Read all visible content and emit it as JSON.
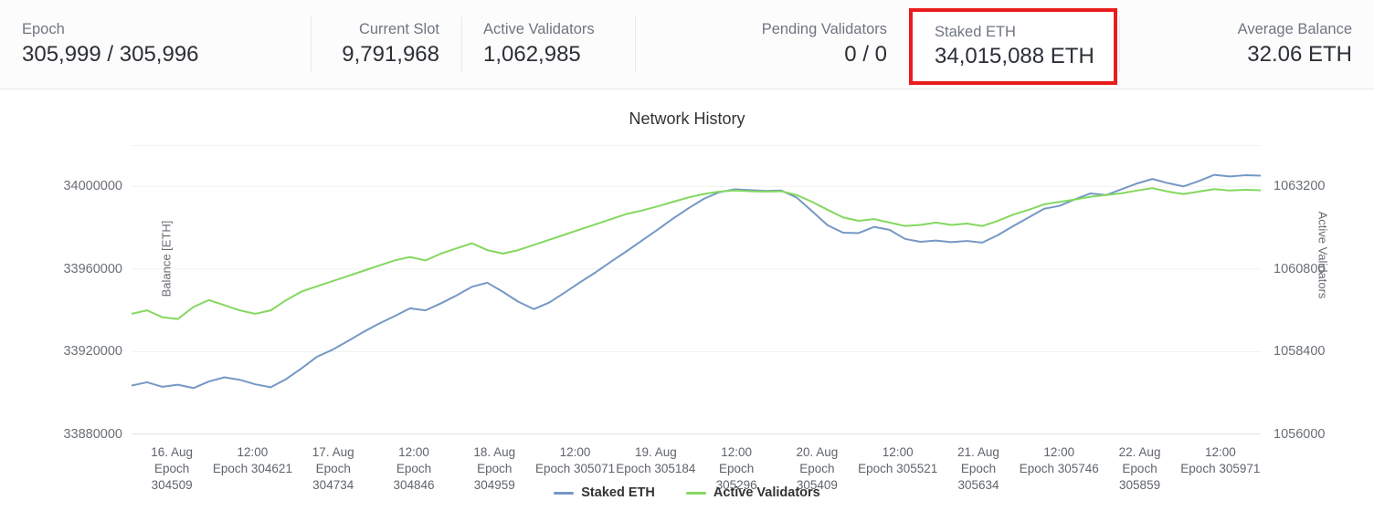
{
  "stats": [
    {
      "id": "epoch",
      "label": "Epoch",
      "value": "305,999 / 305,996",
      "align": "left"
    },
    {
      "id": "current-slot",
      "label": "Current Slot",
      "value": "9,791,968",
      "align": "right"
    },
    {
      "id": "active-validators",
      "label": "Active Validators",
      "value": "1,062,985",
      "align": "left"
    },
    {
      "id": "pending-validators",
      "label": "Pending Validators",
      "value": "0 / 0",
      "align": "right"
    },
    {
      "id": "staked-eth",
      "label": "Staked ETH",
      "value": "34,015,088 ETH",
      "align": "left"
    },
    {
      "id": "average-balance",
      "label": "Average Balance",
      "value": "32.06 ETH",
      "align": "right"
    }
  ],
  "highlight": {
    "target": "staked-eth",
    "color": "#e81c1c",
    "label": "Staked ETH",
    "value": "34,015,088 ETH"
  },
  "chart_data": {
    "type": "line",
    "title": "Network History",
    "xlabel": "",
    "ylabel": "Balance [ETH]",
    "y2label": "Active Validators",
    "grid": true,
    "legend_position": "bottom",
    "ylim": [
      33880000,
      34020000
    ],
    "yticks": [
      33880000,
      33920000,
      33960000,
      34000000
    ],
    "ytick_labels": [
      "33880000",
      "33920000",
      "33960000",
      "34000000"
    ],
    "y2lim": [
      1056000,
      1064400
    ],
    "y2ticks": [
      1056000,
      1058400,
      1060800,
      1063200
    ],
    "y2tick_labels": [
      "1056000",
      "1058400",
      "1060800",
      "1063200"
    ],
    "xtick_labels": [
      "16. Aug\nEpoch\n304509",
      "12:00\nEpoch 304621",
      "17. Aug\nEpoch\n304734",
      "12:00\nEpoch\n304846",
      "18. Aug\nEpoch\n304959",
      "12:00\nEpoch 305071",
      "19. Aug\nEpoch 305184",
      "12:00\nEpoch\n305296",
      "20. Aug\nEpoch\n305409",
      "12:00\nEpoch 305521",
      "21. Aug\nEpoch\n305634",
      "12:00\nEpoch 305746",
      "22. Aug\nEpoch\n305859",
      "12:00\nEpoch 305971"
    ],
    "xtick_widths": [
      "narrow",
      "wide",
      "narrow",
      "narrow",
      "narrow",
      "wide",
      "wide",
      "narrow",
      "narrow",
      "wide",
      "narrow",
      "wide",
      "narrow",
      "wide"
    ],
    "series": [
      {
        "name": "Staked ETH",
        "color": "#7598c4",
        "axis": "left",
        "values": [
          33903600,
          33905200,
          33903000,
          33904000,
          33902400,
          33905600,
          33907600,
          33906400,
          33904200,
          33902800,
          33906800,
          33912000,
          33917600,
          33921000,
          33925200,
          33929600,
          33933600,
          33937200,
          33941000,
          33940000,
          33943400,
          33947200,
          33951400,
          33953400,
          33949000,
          33944200,
          33940600,
          33943800,
          33948600,
          33953600,
          33958400,
          33963600,
          33968600,
          33973800,
          33979000,
          33984400,
          33989400,
          33994000,
          33997200,
          33998600,
          33998200,
          33997800,
          33998000,
          33994600,
          33988000,
          33981200,
          33977600,
          33977400,
          33980400,
          33979000,
          33974600,
          33973200,
          33973800,
          33973000,
          33973600,
          33972800,
          33976400,
          33980800,
          33985000,
          33989200,
          33990600,
          33993800,
          33996600,
          33995800,
          33998600,
          34001400,
          34003600,
          34001600,
          34000000,
          34002600,
          34005600,
          34004800,
          34005400,
          34005200
        ]
      },
      {
        "name": "Active Validators",
        "color": "#84d85f",
        "axis": "right",
        "values": [
          1059500,
          1059600,
          1059400,
          1059350,
          1059700,
          1059900,
          1059750,
          1059600,
          1059500,
          1059600,
          1059900,
          1060150,
          1060300,
          1060450,
          1060600,
          1060750,
          1060900,
          1061050,
          1061150,
          1061050,
          1061250,
          1061400,
          1061550,
          1061350,
          1061250,
          1061350,
          1061500,
          1061650,
          1061800,
          1061950,
          1062100,
          1062250,
          1062400,
          1062500,
          1062620,
          1062750,
          1062880,
          1062980,
          1063050,
          1063080,
          1063060,
          1063050,
          1063060,
          1062950,
          1062750,
          1062520,
          1062300,
          1062200,
          1062250,
          1062150,
          1062050,
          1062080,
          1062150,
          1062080,
          1062120,
          1062050,
          1062200,
          1062380,
          1062520,
          1062680,
          1062750,
          1062820,
          1062900,
          1062950,
          1063000,
          1063080,
          1063150,
          1063050,
          1062980,
          1063050,
          1063120,
          1063080,
          1063100,
          1063090
        ]
      }
    ],
    "legend": [
      {
        "label": "Staked ETH",
        "color": "#7598c4"
      },
      {
        "label": "Active Validators",
        "color": "#84d85f"
      }
    ]
  }
}
